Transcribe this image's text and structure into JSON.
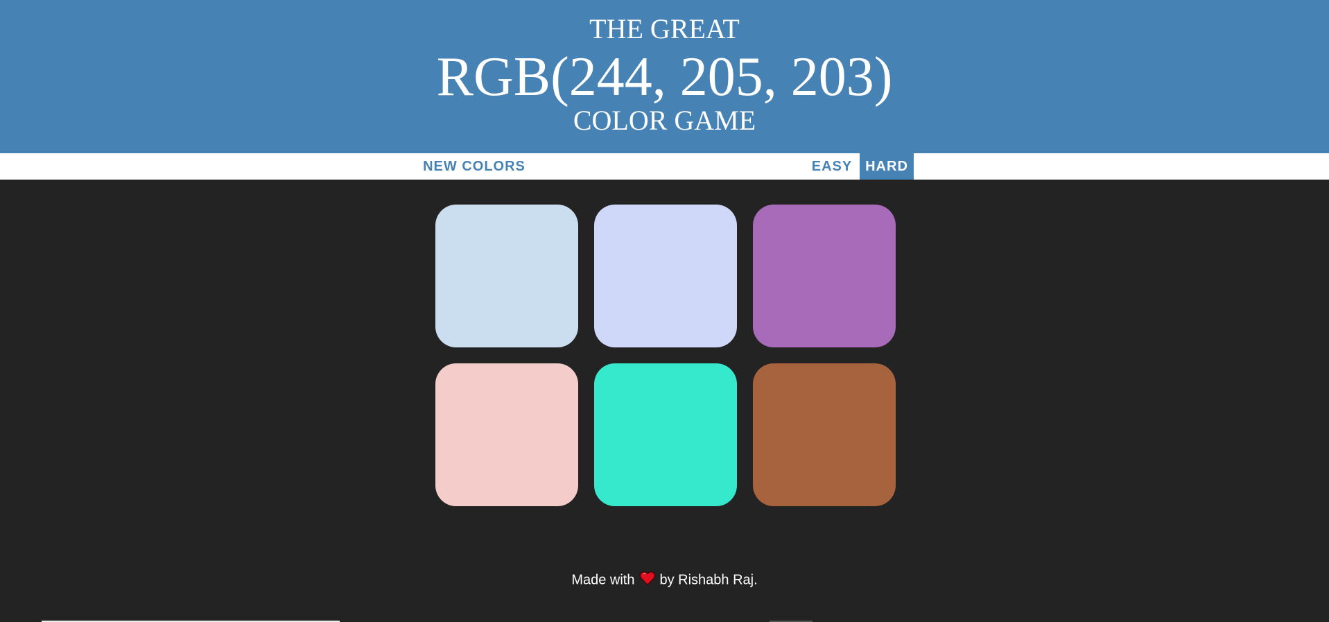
{
  "header": {
    "line1": "THE GREAT",
    "rgb_display": "RGB(244, 205, 203)",
    "line3": "COLOR GAME",
    "background_color": "#4682b4"
  },
  "controls": {
    "new_colors_label": "NEW COLORS",
    "easy_label": "EASY",
    "hard_label": "HARD",
    "selected_mode": "HARD"
  },
  "squares": [
    {
      "color": "#cbdeef"
    },
    {
      "color": "#d0d8fa"
    },
    {
      "color": "#a76bb9"
    },
    {
      "color": "#f4cdcb"
    },
    {
      "color": "#36e8cc"
    },
    {
      "color": "#a7623e"
    }
  ],
  "footer": {
    "made_with": "Made with",
    "heart_icon": "heart-icon",
    "by_text": "by Rishabh Raj."
  },
  "colors": {
    "page_background": "#232323",
    "accent": "#4682b4"
  }
}
